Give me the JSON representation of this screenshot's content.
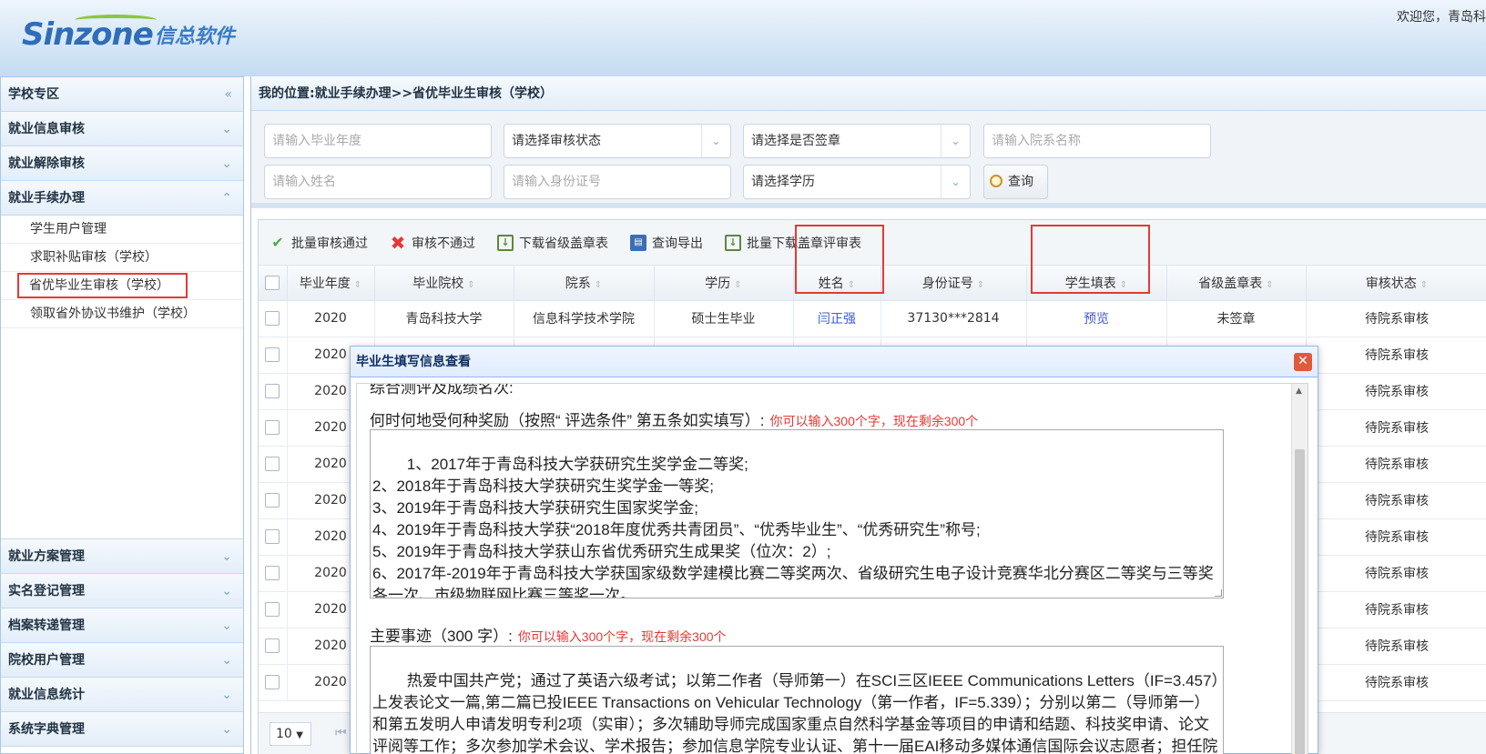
{
  "header": {
    "logo_en": "Sinzone",
    "logo_cn": "信总软件",
    "welcome": "欢迎您，青岛科"
  },
  "sidebar": {
    "title": "学校专区",
    "sections": [
      {
        "label": "就业信息审核"
      },
      {
        "label": "就业解除审核"
      },
      {
        "label": "就业手续办理"
      }
    ],
    "sub_items": [
      {
        "label": "学生用户管理"
      },
      {
        "label": "求职补贴审核（学校）"
      },
      {
        "label": "省优毕业生审核（学校）"
      },
      {
        "label": "领取省外协议书维护（学校）"
      }
    ],
    "bottom_sections": [
      {
        "label": "就业方案管理"
      },
      {
        "label": "实名登记管理"
      },
      {
        "label": "档案转递管理"
      },
      {
        "label": "院校用户管理"
      },
      {
        "label": "就业信息统计"
      },
      {
        "label": "系统字典管理"
      }
    ]
  },
  "breadcrumb": "我的位置:就业手续办理>>省优毕业生审核（学校）",
  "filters": {
    "year_placeholder": "请输入毕业年度",
    "status_select": "请选择审核状态",
    "seal_select": "请选择是否签章",
    "dept_placeholder": "请输入院系名称",
    "name_placeholder": "请输入姓名",
    "id_placeholder": "请输入身份证号",
    "edu_select": "请选择学历",
    "search_label": "查询"
  },
  "toolbar": {
    "approve": "批量审核通过",
    "reject": "审核不通过",
    "download_seal": "下载省级盖章表",
    "export": "查询导出",
    "batch_download": "批量下载盖章评审表"
  },
  "table": {
    "columns": [
      "毕业年度",
      "毕业院校",
      "院系",
      "学历",
      "姓名",
      "身份证号",
      "学生填表",
      "省级盖章表",
      "审核状态"
    ],
    "first_row": {
      "year": "2020",
      "school": "青岛科技大学",
      "dept": "信息科学技术学院",
      "edu": "硕士生毕业",
      "name": "闫正强",
      "id": "37130***2814",
      "form": "预览",
      "seal": "未签章",
      "status": "待院系审核"
    },
    "other_rows": [
      {
        "year": "2020",
        "status": "待院系审核"
      },
      {
        "year": "2020",
        "status": "待院系审核"
      },
      {
        "year": "2020",
        "status": "待院系审核"
      },
      {
        "year": "2020",
        "status": "待院系审核"
      },
      {
        "year": "2020",
        "status": "待院系审核"
      },
      {
        "year": "2020",
        "status": "待院系审核"
      },
      {
        "year": "2020",
        "status": "待院系审核"
      },
      {
        "year": "2020",
        "status": "待院系审核"
      },
      {
        "year": "2020",
        "status": "待院系审核"
      },
      {
        "year": "2020",
        "status": "待院系审核"
      }
    ]
  },
  "pager": {
    "page_size": "10"
  },
  "modal": {
    "title": "毕业生填写信息查看",
    "cut_off_label": "综合测评及成绩名次:",
    "awards_label": "何时何地受何种奖励（按照“ 评选条件” 第五条如实填写）:",
    "awards_hint": "你可以输入300个字，现在剩余300个",
    "awards_text": "1、2017年于青岛科技大学获研究生奖学金二等奖;\n2、2018年于青岛科技大学获研究生奖学金一等奖;\n3、2019年于青岛科技大学获研究生国家奖学金;\n4、2019年于青岛科技大学获“2018年度优秀共青团员”、“优秀毕业生”、“优秀研究生”称号;\n5、2019年于青岛科技大学获山东省优秀研究生成果奖（位次：2）;\n6、2017年-2019年于青岛科技大学获国家级数学建模比赛二等奖两次、省级研究生电子设计竞赛华北分赛区二等奖与三等奖各一次、市级物联网比赛三等奖一次。",
    "deeds_label": "主要事迹（300 字）:",
    "deeds_hint": "你可以输入300个字，现在剩余300个",
    "deeds_text": "热爱中国共产党；通过了英语六级考试；以第二作者（导师第一）在SCI三区IEEE Communications Letters（IF=3.457）上发表论文一篇,第二篇已投IEEE Transactions on Vehicular Technology（第一作者，IF=5.339）；分别以第二（导师第一）和第五发明人申请发明专利2项（实审）；多次辅助导师完成国家重点自然科学基金等项目的申请和结题、科技奖申请、论文评阅等工作；多次参加学术会议、学术报告；参加信息学院专业认证、第十一届EAI移动多媒体通信国际会议志愿者；担任院研究生会副主席，参与宿舍卫生检查、举办新生晚会并表演节目。"
  }
}
